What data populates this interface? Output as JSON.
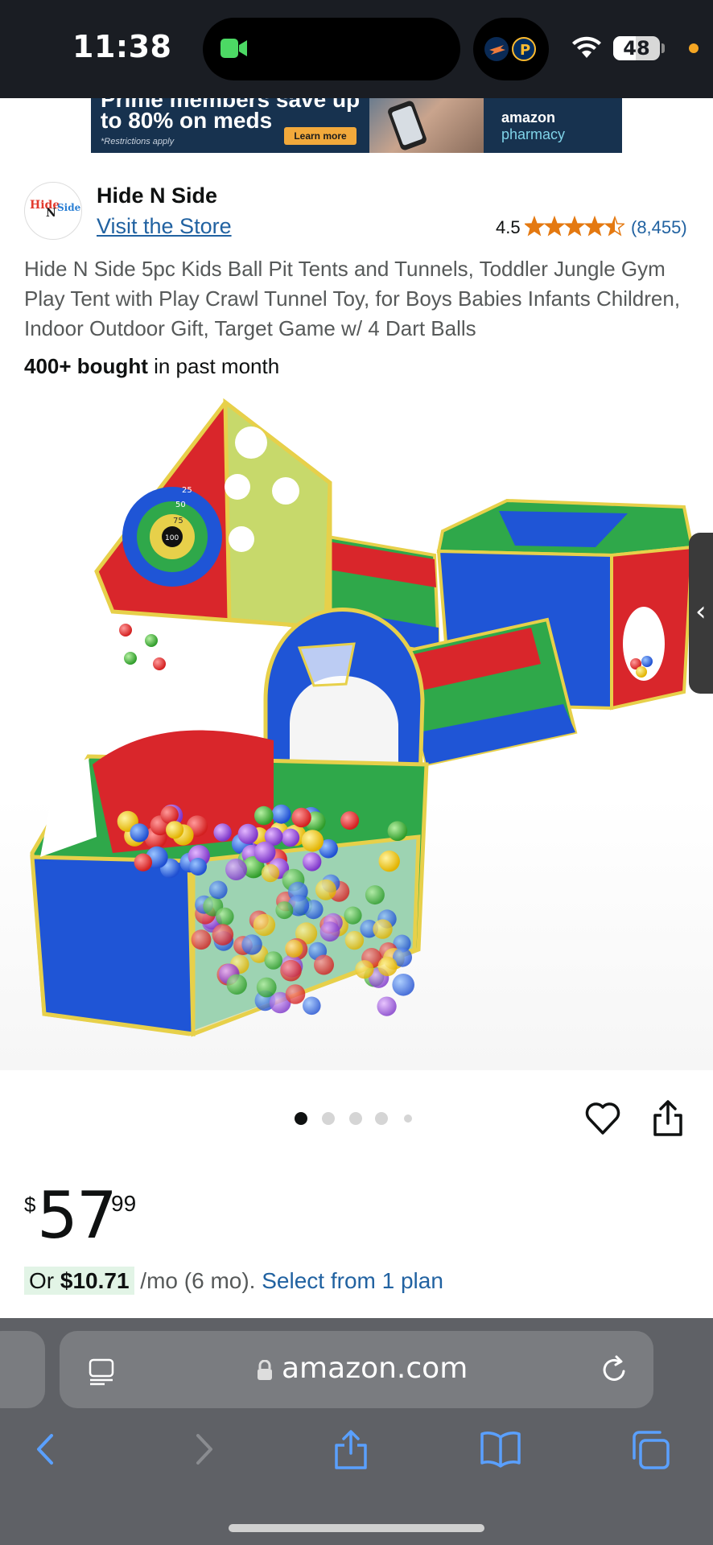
{
  "status_bar": {
    "time": "11:38",
    "battery": "48",
    "battery_level_percent": 48,
    "icons": [
      "facetime-camera-icon",
      "thunder-logo-icon",
      "pacers-logo-icon",
      "wifi-icon",
      "battery-icon"
    ]
  },
  "ad": {
    "headline_top": "Prime members save up",
    "headline": "to 80% on meds",
    "footnote": "*Restrictions apply",
    "cta": "Learn more",
    "brand": "amazon",
    "brand_accent": "pharmacy"
  },
  "brand": {
    "name": "Hide N Side",
    "visit_store": "Visit the Store",
    "logo_text": [
      "Hide",
      "N",
      "Side"
    ],
    "rating": "4.5",
    "rating_value": 4.5,
    "rating_count": "(8,455)"
  },
  "product": {
    "title": "Hide N Side 5pc Kids Ball Pit Tents and Tunnels, Toddler Jungle Gym Play Tent with Play Crawl Tunnel Toy, for Boys Babies Infants Children, Indoor Outdoor Gift, Target Game w/ 4 Dart Balls",
    "bought_strong": "400+ bought",
    "bought_rest": " in past month",
    "target_labels": [
      "25",
      "50",
      "75",
      "100"
    ]
  },
  "carousel": {
    "count": 5,
    "active_index": 0
  },
  "price": {
    "symbol": "$",
    "whole": "57",
    "fraction": "99"
  },
  "installment": {
    "prefix": "Or ",
    "amount": "$10.71",
    "term": " /mo (6 mo). ",
    "link": "Select from 1 plan"
  },
  "browser": {
    "address": "amazon.com"
  },
  "colors": {
    "status_bar": "#1a1d23",
    "link": "#2162a1",
    "star": "#e47911",
    "browser_bar": "#5f6166",
    "nav_icon": "#5aa0ff",
    "installment_badge": "#e2f4e6"
  }
}
